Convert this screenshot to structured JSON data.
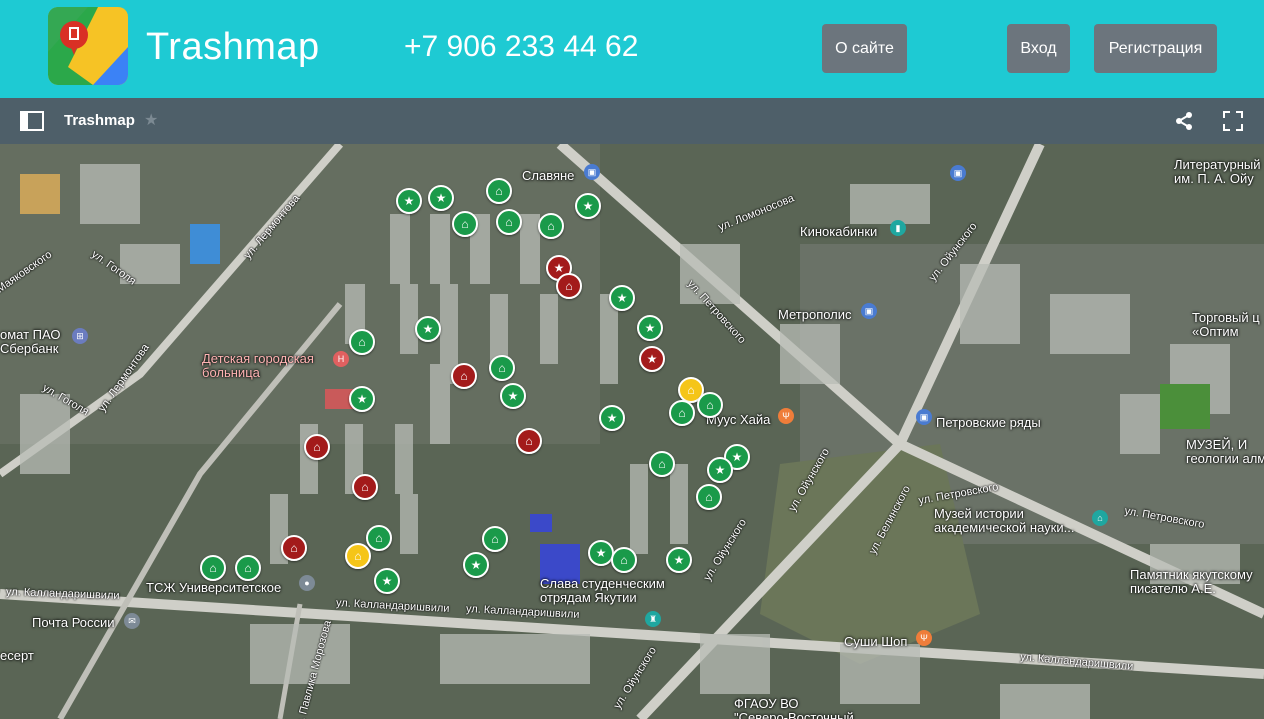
{
  "header": {
    "brand": "Trashmap",
    "phone": "+7 906 233 44 62",
    "nav": {
      "about": "О сайте",
      "login": "Вход",
      "register": "Регистрация"
    }
  },
  "mapbar": {
    "title": "Trashmap",
    "star": "★"
  },
  "colors": {
    "header_bg": "#1ecad3",
    "button_bg": "#6c757d",
    "mapbar_bg": "#4e5f69",
    "marker_green": "#1a9a4a",
    "marker_red": "#a31b1b",
    "marker_yellow": "#f5c518"
  },
  "map": {
    "streets": [
      "ул. Лермонтова",
      "ул. Гоголя",
      "ул. Лермонтова",
      "ул. Гоголя",
      "Маяковского",
      "ул. Ломоносова",
      "ул. Петровского",
      "ул. Ойунского",
      "ул. Ойунского",
      "ул. Ойунского",
      "ул. Белинского",
      "ул. Петровского",
      "ул. Петровского",
      "ул. Калландаришвили",
      "ул. Калландаришвили",
      "ул. Калландаришвили",
      "ул. Калландаришвили",
      "ул. Павлика Морозова",
      "ул. Ойунского"
    ],
    "places": [
      "Славяне",
      "Литературный\nим. П. А. Ойу",
      "Кинокабинки",
      "Метрополис",
      "Торговый ц\n«Оптим",
      "омат ПАО\nСбербанк",
      "Детская городская\nбольница",
      "Муус Хайа",
      "Петровские ряды",
      "МУЗЕЙ, И\nгеологии алм",
      "Музей истории\nакадемической науки...",
      "Памятник якутскому\nписателю А.Е.",
      "ТСЖ Университетское",
      "Почта России",
      "Слава студенческим\nотрядам Якутии",
      "Суши Шоп",
      "есерт",
      "ФГАОУ ВО\n\"Северо-Восточный"
    ]
  }
}
